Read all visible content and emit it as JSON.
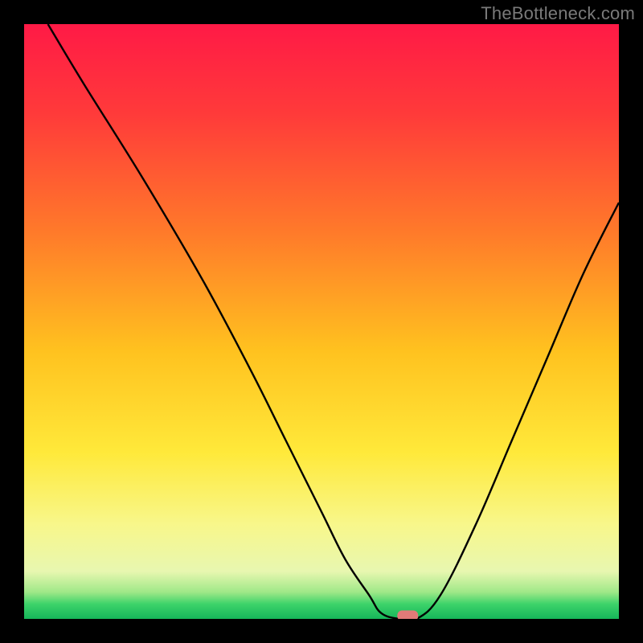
{
  "watermark": "TheBottleneck.com",
  "chart_data": {
    "type": "line",
    "title": "",
    "xlabel": "",
    "ylabel": "",
    "xlim": [
      0,
      100
    ],
    "ylim": [
      0,
      100
    ],
    "grid": false,
    "legend": false,
    "background": {
      "type": "vertical-gradient",
      "description": "Red at top through orange, yellow, pale yellow, to thin green band at bottom representing bottleneck severity (green = optimal).",
      "stops": [
        {
          "pos": 0.0,
          "color": "#ff1a46"
        },
        {
          "pos": 0.15,
          "color": "#ff3a3a"
        },
        {
          "pos": 0.35,
          "color": "#ff7a2a"
        },
        {
          "pos": 0.55,
          "color": "#ffc21f"
        },
        {
          "pos": 0.72,
          "color": "#ffe93a"
        },
        {
          "pos": 0.84,
          "color": "#f8f78a"
        },
        {
          "pos": 0.92,
          "color": "#e8f7b0"
        },
        {
          "pos": 0.955,
          "color": "#9fe888"
        },
        {
          "pos": 0.975,
          "color": "#3dd36a"
        },
        {
          "pos": 1.0,
          "color": "#16b65a"
        }
      ]
    },
    "series": [
      {
        "name": "bottleneck-curve",
        "stroke": "#000000",
        "x": [
          4,
          10,
          20,
          30,
          38,
          44,
          50,
          54,
          58,
          60,
          63,
          66,
          70,
          76,
          82,
          88,
          94,
          100
        ],
        "y": [
          100,
          90,
          74,
          57,
          42,
          30,
          18,
          10,
          4,
          1,
          0,
          0,
          4,
          16,
          30,
          44,
          58,
          70
        ]
      }
    ],
    "marker": {
      "name": "optimal-point",
      "x": 64.5,
      "y": 0,
      "color": "#e17a78",
      "shape": "rounded-pill"
    }
  }
}
